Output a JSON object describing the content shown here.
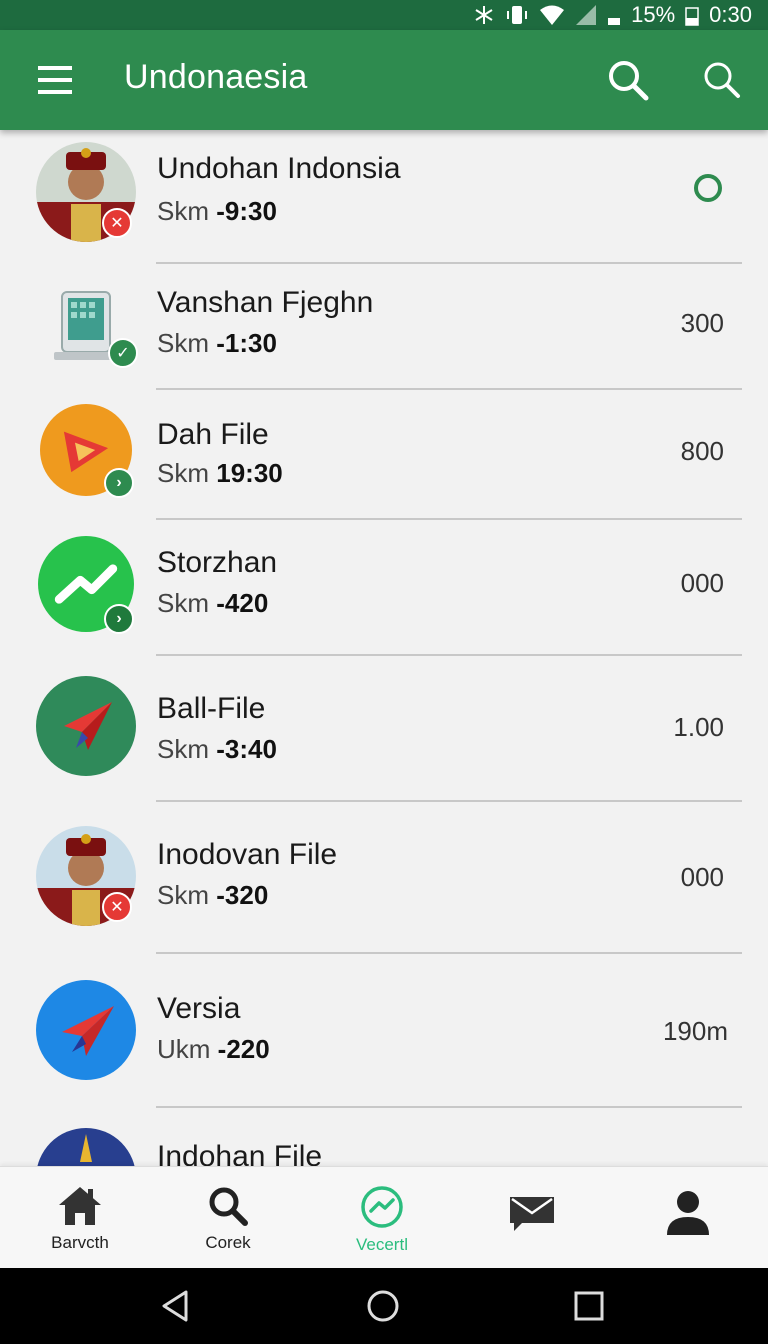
{
  "status_bar": {
    "battery": "15%",
    "time": "0:30"
  },
  "app_bar": {
    "title": "Undonaesia",
    "icons": [
      "menu-icon",
      "search-icon",
      "search-icon"
    ]
  },
  "items": [
    {
      "title": "Undohan Indonsia",
      "sub_key": "Skm",
      "sub_value": "-9:30",
      "value": "",
      "avatar": "portrait",
      "badge": "x"
    },
    {
      "title": "Vanshan Fjeghn",
      "sub_key": "Skm",
      "sub_value": "-1:30",
      "value": "300",
      "avatar": "device",
      "badge": "check"
    },
    {
      "title": "Dah File",
      "sub_key": "Skm",
      "sub_value": "19:30",
      "value": "800",
      "avatar": "orange-play",
      "badge": "chevron"
    },
    {
      "title": "Storzhan",
      "sub_key": "Skm",
      "sub_value": "-420",
      "value": "000",
      "avatar": "green-trend",
      "badge": "chevron"
    },
    {
      "title": "Ball-File",
      "sub_key": "Skm",
      "sub_value": "-3:40",
      "value": "1.00",
      "avatar": "green-plane",
      "badge": ""
    },
    {
      "title": "Inodovan File",
      "sub_key": "Skm",
      "sub_value": "-320",
      "value": "000",
      "avatar": "portrait",
      "badge": "x"
    },
    {
      "title": "Versia",
      "sub_key": "Ukm",
      "sub_value": "-220",
      "value": "190m",
      "avatar": "blue-plane",
      "badge": ""
    },
    {
      "title": "Indohan File",
      "sub_key": "",
      "sub_value": "",
      "value": "",
      "avatar": "navy-compass",
      "badge": ""
    }
  ],
  "bottom_nav": [
    {
      "label": "Barvcth",
      "icon": "home-icon"
    },
    {
      "label": "Corek",
      "icon": "search-icon"
    },
    {
      "label": "Vecertl",
      "icon": "trend-icon",
      "active": true
    },
    {
      "label": "",
      "icon": "mail-icon"
    },
    {
      "label": "",
      "icon": "person-icon"
    }
  ],
  "colors": {
    "app_bar": "#2e8b4f",
    "status_bar": "#1e6b3f",
    "accent_active": "#2bbd7e",
    "badge_red": "#e53935"
  }
}
